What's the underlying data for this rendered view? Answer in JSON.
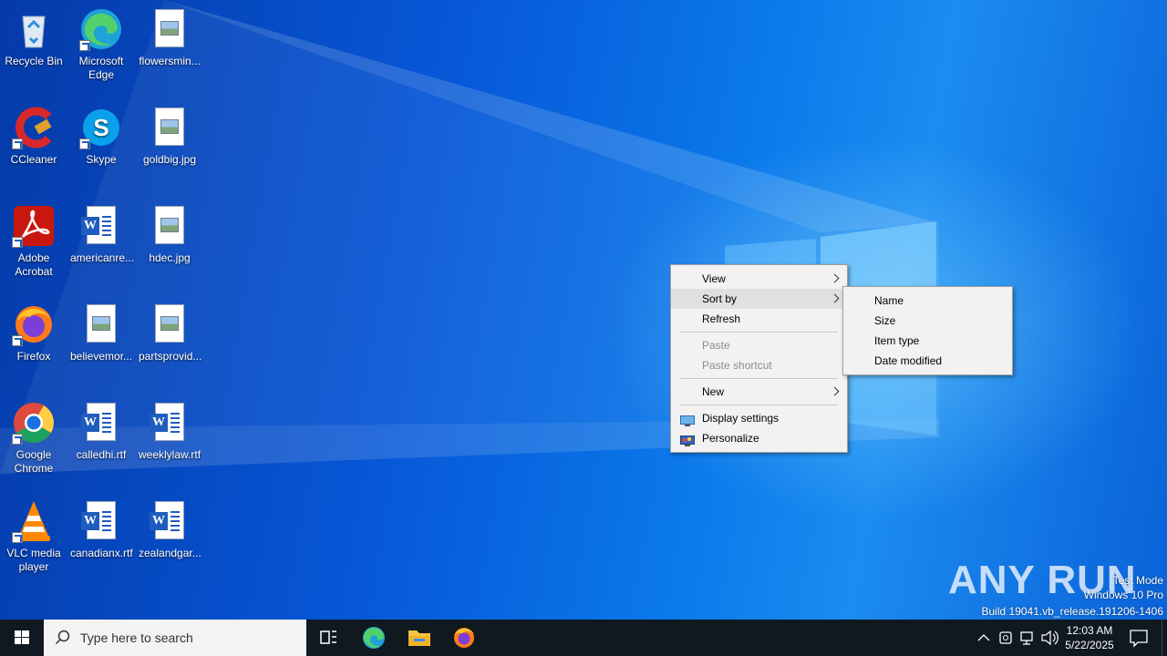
{
  "desktop": {
    "icons": [
      {
        "label": "Recycle Bin",
        "icon": "recycle-bin-icon"
      },
      {
        "label": "Microsoft Edge",
        "icon": "edge-icon"
      },
      {
        "label": "flowersmin...",
        "icon": "image-file-icon"
      },
      {
        "label": "CCleaner",
        "icon": "ccleaner-icon"
      },
      {
        "label": "Skype",
        "icon": "skype-icon"
      },
      {
        "label": "goldbig.jpg",
        "icon": "image-file-icon"
      },
      {
        "label": "Adobe Acrobat",
        "icon": "acrobat-icon"
      },
      {
        "label": "americanre...",
        "icon": "word-doc-icon"
      },
      {
        "label": "hdec.jpg",
        "icon": "image-file-icon"
      },
      {
        "label": "Firefox",
        "icon": "firefox-icon"
      },
      {
        "label": "believemor...",
        "icon": "image-file-icon"
      },
      {
        "label": "partsprovid...",
        "icon": "image-file-icon"
      },
      {
        "label": "Google Chrome",
        "icon": "chrome-icon"
      },
      {
        "label": "calledhi.rtf",
        "icon": "word-doc-icon"
      },
      {
        "label": "weeklylaw.rtf",
        "icon": "word-doc-icon"
      },
      {
        "label": "VLC media player",
        "icon": "vlc-icon"
      },
      {
        "label": "canadianx.rtf",
        "icon": "word-doc-icon"
      },
      {
        "label": "zealandgar...",
        "icon": "word-doc-icon"
      }
    ]
  },
  "context_menu": {
    "view": "View",
    "sort_by": "Sort by",
    "refresh": "Refresh",
    "paste": "Paste",
    "paste_shortcut": "Paste shortcut",
    "new": "New",
    "display_settings": "Display settings",
    "personalize": "Personalize"
  },
  "sort_submenu": {
    "name": "Name",
    "size": "Size",
    "item_type": "Item type",
    "date_modified": "Date modified"
  },
  "watermark": {
    "brand": "ANY RUN",
    "line1": "Test Mode",
    "line2": "Windows 10 Pro",
    "line3": "Build 19041.vb_release.191206-1406"
  },
  "taskbar": {
    "search_placeholder": "Type here to search",
    "time": "12:03 AM",
    "date": "5/22/2025",
    "pinned": [
      "task-view-icon",
      "edge-icon",
      "file-explorer-icon",
      "firefox-icon"
    ]
  },
  "colors": {
    "taskbar_bg": "#101820",
    "menu_bg": "#f2f2f2",
    "menu_highlight": "#e0e0e0",
    "desktop_blue": "#0a62d8"
  }
}
